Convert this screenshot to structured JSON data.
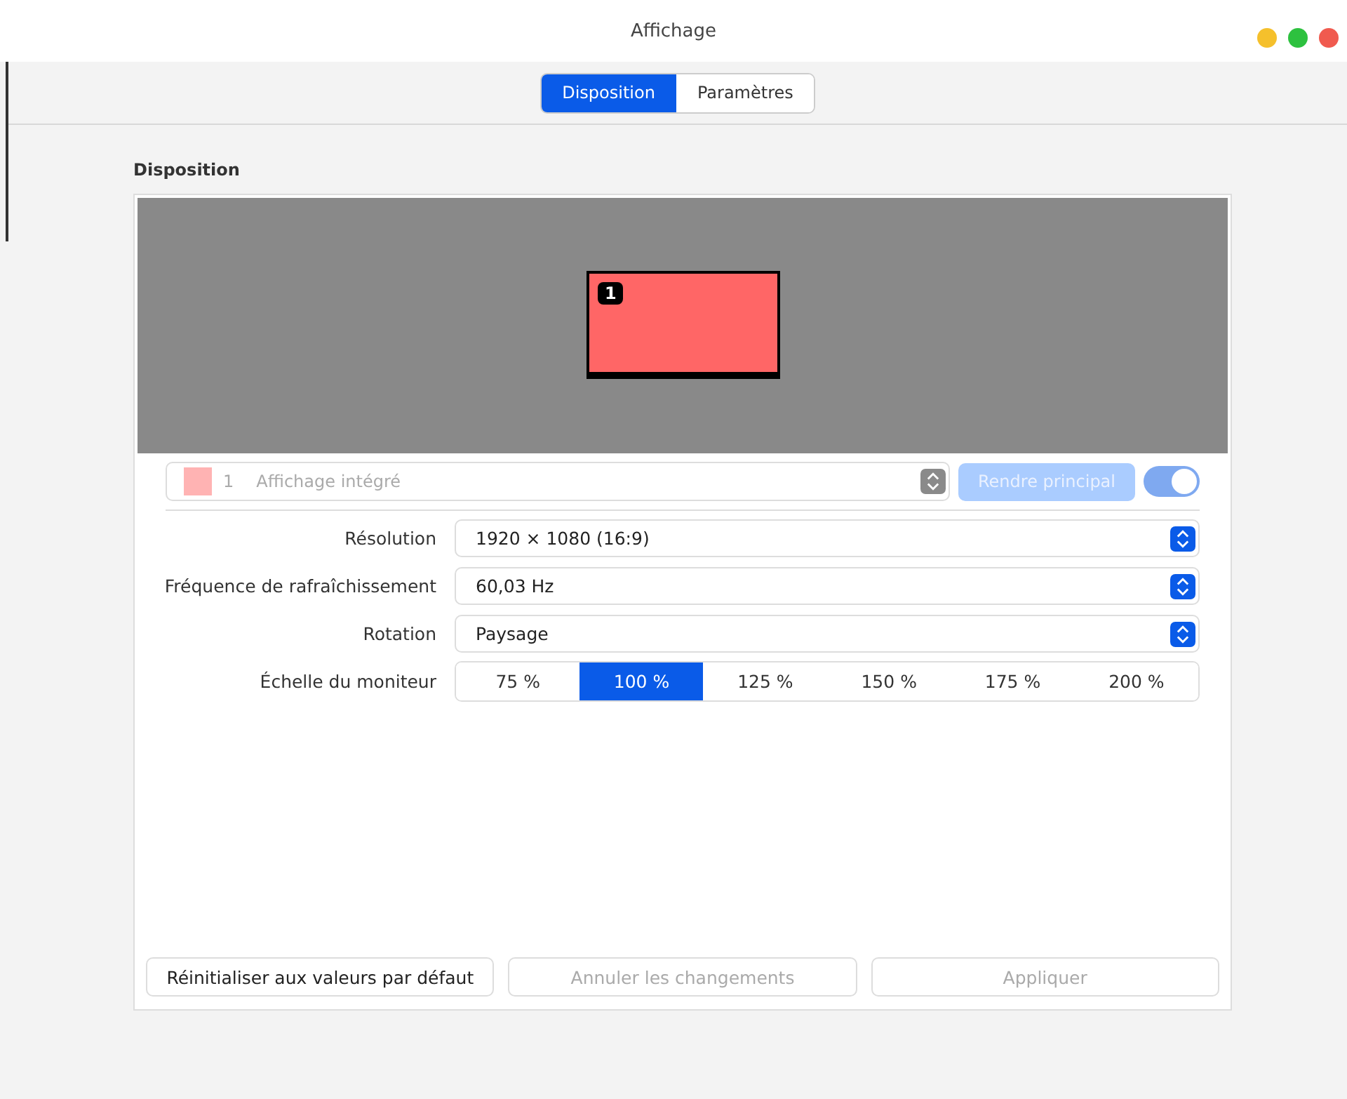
{
  "window": {
    "title": "Affichage"
  },
  "tabs": [
    {
      "label": "Disposition",
      "selected": true
    },
    {
      "label": "Paramètres",
      "selected": false
    }
  ],
  "section_title": "Disposition",
  "monitors": [
    {
      "number": "1",
      "color": "#ff6666"
    }
  ],
  "display_selector": {
    "number": "1",
    "name": "Affichage intégré",
    "color": "#ffb3b3",
    "disabled": true
  },
  "make_primary": {
    "label": "Rendre principal",
    "disabled": true
  },
  "display_toggle": {
    "on": true
  },
  "settings": [
    {
      "kind": "select",
      "label": "Résolution",
      "value": "1920 × 1080 (16:9)"
    },
    {
      "kind": "select",
      "label": "Fréquence de rafraîchissement",
      "value": "60,03 Hz"
    },
    {
      "kind": "select",
      "label": "Rotation",
      "value": "Paysage"
    },
    {
      "kind": "segmented",
      "label": "Échelle du moniteur",
      "options": [
        {
          "label": "75 %",
          "selected": false
        },
        {
          "label": "100 %",
          "selected": true
        },
        {
          "label": "125 %",
          "selected": false
        },
        {
          "label": "150 %",
          "selected": false
        },
        {
          "label": "175 %",
          "selected": false
        },
        {
          "label": "200 %",
          "selected": false
        }
      ]
    }
  ],
  "buttons": [
    {
      "label": "Réinitialiser aux valeurs par défaut",
      "disabled": false
    },
    {
      "label": "Annuler les changements",
      "disabled": true
    },
    {
      "label": "Appliquer",
      "disabled": true
    }
  ]
}
